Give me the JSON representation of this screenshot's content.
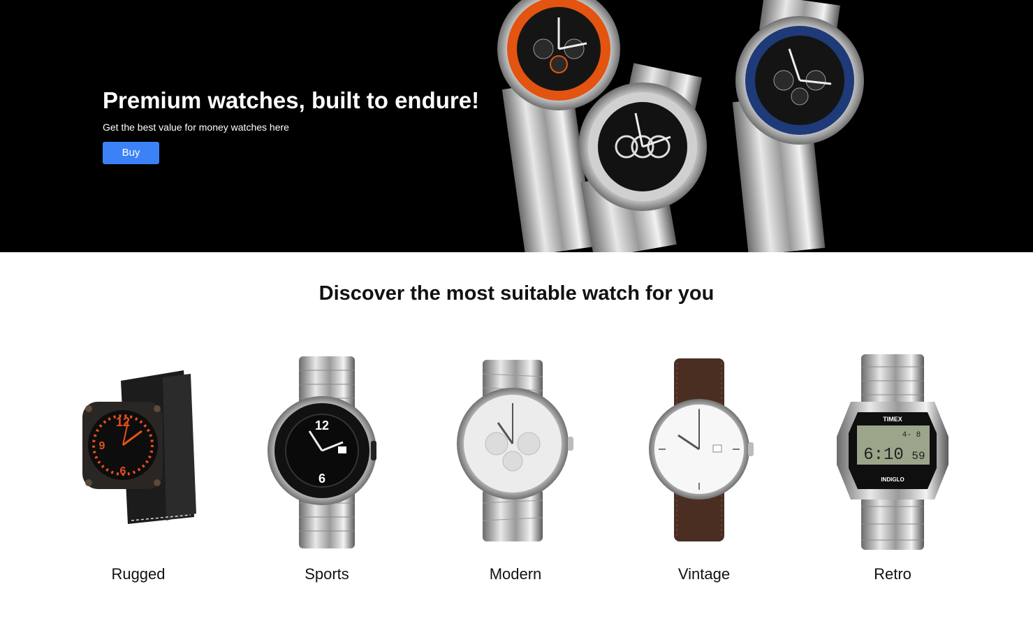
{
  "hero": {
    "title": "Premium watches, built to endure!",
    "subtitle": "Get the best value for money watches here",
    "buy_label": "Buy",
    "accent": "#3b82f6"
  },
  "section": {
    "title": "Discover the most suitable watch for you"
  },
  "categories": [
    {
      "label": "Rugged",
      "icon": "rugged-watch"
    },
    {
      "label": "Sports",
      "icon": "sports-watch"
    },
    {
      "label": "Modern",
      "icon": "modern-watch"
    },
    {
      "label": "Vintage",
      "icon": "vintage-watch"
    },
    {
      "label": "Retro",
      "icon": "retro-watch"
    }
  ],
  "retro_display": {
    "brand": "TIMEX",
    "time": "6:10",
    "seconds": "59",
    "date": "4- 8",
    "indiglo": "INDIGLO"
  }
}
